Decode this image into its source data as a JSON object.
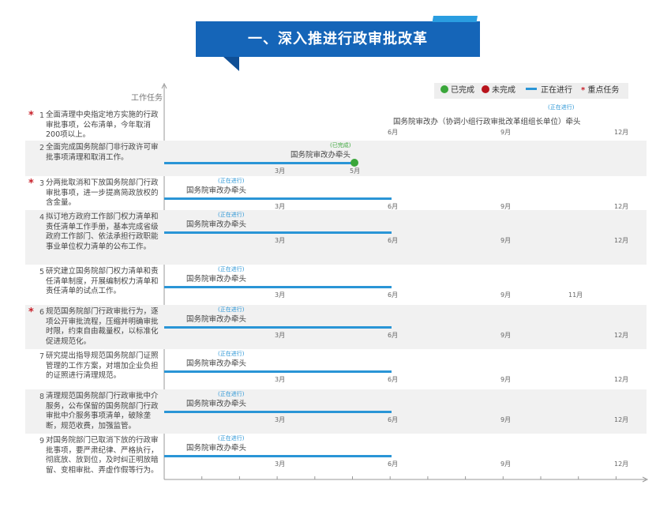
{
  "header": {
    "title": "一、深入推进行政审批改革"
  },
  "legend": {
    "completed": "已完成",
    "not_completed": "未完成",
    "in_progress": "正在进行",
    "key_task": "重点任务",
    "star": "*",
    "colors": {
      "completed": "#3aa63a",
      "not_completed": "#b8141c",
      "in_progress": "#2a95d6",
      "key_task": "#c8202a"
    }
  },
  "chart_data": {
    "type": "gantt",
    "ylabel": "工作任务",
    "tasks": [
      {
        "num": "1",
        "key": true,
        "text": "全面清理中央指定地方实施的行政审批事项，公布清单，今年取消200项以上。",
        "status": "(正在进行)",
        "state": "in_progress",
        "lead": "国务院审改办（协调小组行政审批改革组组长单位）牵头",
        "bar_end_month": null,
        "months": [
          "6月",
          "9月",
          "12月"
        ],
        "month_values": [
          6,
          9,
          12
        ]
      },
      {
        "num": "2",
        "key": false,
        "text": "全面完成国务院部门非行政许可审批事项清理和取消工作。",
        "status": "(已完成)",
        "state": "completed",
        "lead": "国务院审改办牵头",
        "bar_end_month": 5,
        "months": [
          "3月",
          "5月"
        ],
        "month_values": [
          3,
          5
        ]
      },
      {
        "num": "3",
        "key": true,
        "text": "分两批取消和下放国务院部门行政审批事项，进一步提高简政放权的含金量。",
        "status": "(正在进行)",
        "state": "in_progress",
        "lead": "国务院审改办牵头",
        "bar_end_month": 6,
        "months": [
          "3月",
          "6月",
          "9月",
          "12月"
        ],
        "month_values": [
          3,
          6,
          9,
          12
        ]
      },
      {
        "num": "4",
        "key": false,
        "text": "拟订地方政府工作部门权力清单和责任清单工作手册，基本完成省级政府工作部门、依法承担行政职能事业单位权力清单的公布工作。",
        "status": "(正在进行)",
        "state": "in_progress",
        "lead": "国务院审改办牵头",
        "bar_end_month": 6,
        "months": [
          "3月",
          "6月",
          "9月",
          "12月"
        ],
        "month_values": [
          3,
          6,
          9,
          12
        ]
      },
      {
        "num": "5",
        "key": false,
        "text": "研究建立国务院部门权力清单和责任清单制度，开展编制权力清单和责任清单的试点工作。",
        "status": "(正在进行)",
        "state": "in_progress",
        "lead": "国务院审改办牵头",
        "bar_end_month": 6,
        "months": [
          "3月",
          "6月",
          "9月",
          "11月"
        ],
        "month_values": [
          3,
          6,
          9,
          11
        ]
      },
      {
        "num": "6",
        "key": true,
        "text": "规范国务院部门行政审批行为，逐项公开审批流程，压缩并明确审批时限，约束自由裁量权，以标准化促进规范化。",
        "status": "(正在进行)",
        "state": "in_progress",
        "lead": "国务院审改办牵头",
        "bar_end_month": 6,
        "months": [
          "3月",
          "6月",
          "9月",
          "12月"
        ],
        "month_values": [
          3,
          6,
          9,
          12
        ]
      },
      {
        "num": "7",
        "key": false,
        "text": "研究提出指导规范国务院部门证照管理的工作方案，对增加企业负担的证照进行清理规范。",
        "status": "(正在进行)",
        "state": "in_progress",
        "lead": "国务院审改办牵头",
        "bar_end_month": 6,
        "months": [
          "3月",
          "6月",
          "9月",
          "12月"
        ],
        "month_values": [
          3,
          6,
          9,
          12
        ]
      },
      {
        "num": "8",
        "key": false,
        "text": "清理规范国务院部门行政审批中介服务，公布保留的国务院部门行政审批中介服务事项清单，破除垄断，规范收费，加强监管。",
        "status": "(正在进行)",
        "state": "in_progress",
        "lead": "国务院审改办牵头",
        "bar_end_month": 6,
        "months": [
          "3月",
          "6月",
          "9月",
          "12月"
        ],
        "month_values": [
          3,
          6,
          9,
          12
        ]
      },
      {
        "num": "9",
        "key": false,
        "text": "对国务院部门已取消下放的行政审批事项，要严肃纪律、严格执行，彻底放、放到位，及时纠正明放暗留、变相审批、弄虚作假等行为。",
        "status": "(正在进行)",
        "state": "in_progress",
        "lead": "国务院审改办牵头",
        "bar_end_month": 6,
        "months": [
          "3月",
          "6月",
          "9月",
          "12月"
        ],
        "month_values": [
          3,
          6,
          9,
          12
        ]
      }
    ]
  }
}
